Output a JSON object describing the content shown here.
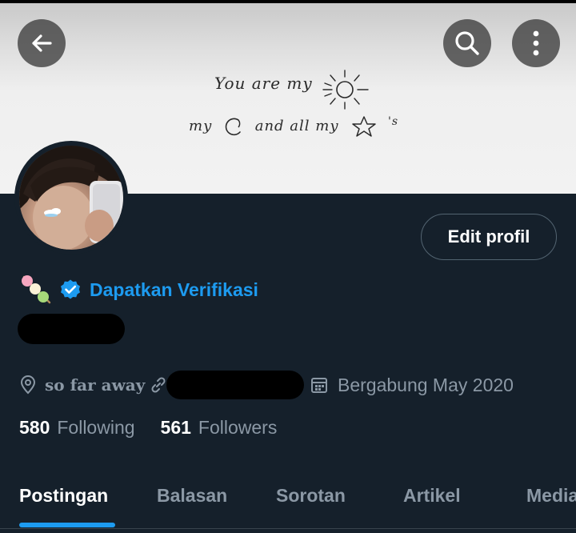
{
  "banner": {
    "line1": "You are my",
    "line2_prefix": "my",
    "line2_mid": "and all my",
    "line2_suffix": "'s"
  },
  "header": {
    "back_icon": "arrow-left-icon",
    "search_icon": "search-icon",
    "more_icon": "more-vertical-icon"
  },
  "profile": {
    "edit_label": "Edit profil",
    "verify_label": "Dapatkan Verifikasi",
    "emoji": "dango-emoji",
    "location": "so far away",
    "joined": "Bergabung May 2020",
    "following_count": "580",
    "following_label": "Following",
    "followers_count": "561",
    "followers_label": "Followers"
  },
  "tabs": [
    {
      "label": "Postingan",
      "active": true
    },
    {
      "label": "Balasan",
      "active": false
    },
    {
      "label": "Sorotan",
      "active": false
    },
    {
      "label": "Artikel",
      "active": false
    },
    {
      "label": "Media",
      "active": false
    }
  ],
  "colors": {
    "background": "#15202b",
    "accent": "#1d9bf0",
    "muted": "#8b98a5"
  }
}
